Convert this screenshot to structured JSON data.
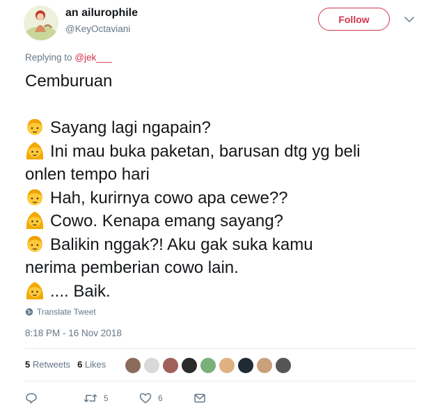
{
  "author": {
    "name": "an ailurophile",
    "handle": "@KeyOctaviani"
  },
  "follow_button": {
    "label": "Follow",
    "color": "#d1344a"
  },
  "reply_context": {
    "prefix": "Replying to ",
    "mention": "@jek___"
  },
  "tweet": {
    "lines": [
      {
        "emoji": "",
        "text": "Cemburuan"
      },
      {
        "emoji": "",
        "text": ""
      },
      {
        "emoji": "man-icon",
        "text": "Sayang lagi ngapain?"
      },
      {
        "emoji": "woman-icon",
        "text": "Ini mau buka paketan, barusan dtg yg beli"
      },
      {
        "emoji": "",
        "text": "onlen tempo hari"
      },
      {
        "emoji": "man-icon",
        "text": "Hah, kurirnya cowo apa cewe??"
      },
      {
        "emoji": "woman-icon",
        "text": "Cowo. Kenapa emang sayang?"
      },
      {
        "emoji": "man-icon",
        "text": "Balikin nggak?! Aku gak suka kamu"
      },
      {
        "emoji": "",
        "text": "nerima pemberian cowo lain."
      },
      {
        "emoji": "woman-icon",
        "text": ".... Baik."
      }
    ]
  },
  "translate_label": "Translate Tweet",
  "timestamp": "8:18 PM - 16 Nov 2018",
  "stats": {
    "retweets_count": "5",
    "retweets_label": "Retweets",
    "likes_count": "6",
    "likes_label": "Likes"
  },
  "likers": [
    {
      "color": "#8c6a5a"
    },
    {
      "color": "#d9d9d9"
    },
    {
      "color": "#a0605a"
    },
    {
      "color": "#2a2a2a"
    },
    {
      "color": "#7ab07a"
    },
    {
      "color": "#e0b080"
    },
    {
      "color": "#1f2a33"
    },
    {
      "color": "#c8a07a"
    },
    {
      "color": "#555555"
    }
  ],
  "actions": {
    "reply_count": "",
    "retweet_count": "5",
    "like_count": "6"
  },
  "colors": {
    "accent": "#d1344a",
    "muted": "#657786",
    "text": "#14171a"
  }
}
